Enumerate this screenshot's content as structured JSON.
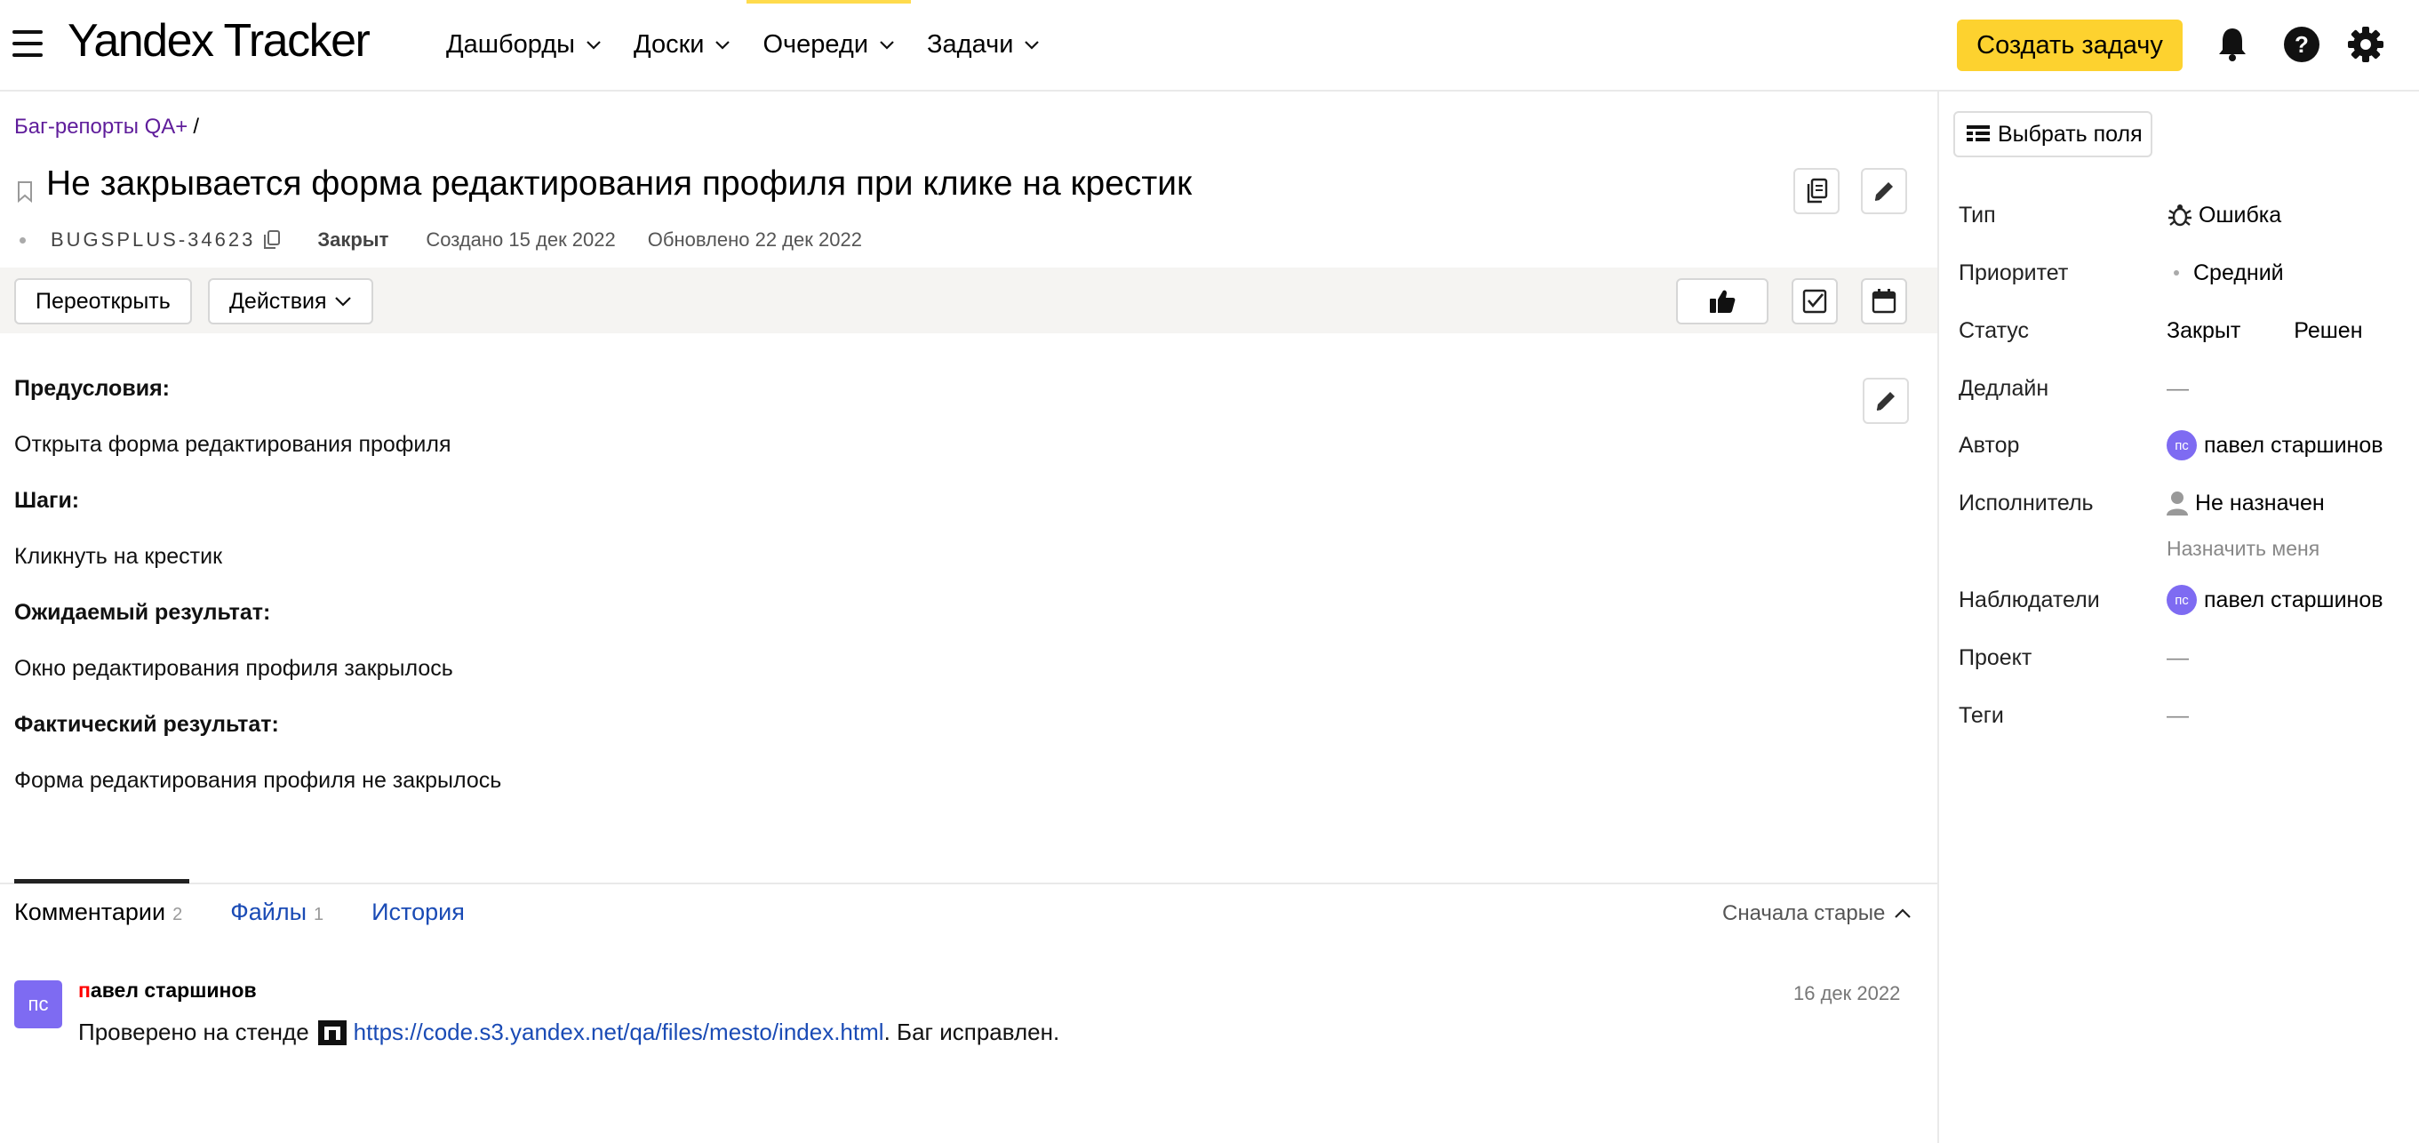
{
  "header": {
    "logo": "Yandex Tracker",
    "nav": [
      {
        "label": "Дашборды"
      },
      {
        "label": "Доски"
      },
      {
        "label": "Очереди"
      },
      {
        "label": "Задачи"
      }
    ],
    "create_button": "Создать задачу"
  },
  "issue": {
    "breadcrumb": "Баг-репорты QA+",
    "breadcrumb_sep": "/",
    "title": "Не закрывается форма редактирования профиля при клике на крестик",
    "key": "BUGSPLUS-34623",
    "status": "Закрыт",
    "created": "Создано 15 дек 2022",
    "updated": "Обновлено 22 дек 2022"
  },
  "actions": {
    "reopen": "Переоткрыть",
    "more": "Действия"
  },
  "description": {
    "pre_title": "Предусловия:",
    "pre_text": "Открыта форма редактирования профиля",
    "steps_title": "Шаги:",
    "steps_text": "Кликнуть на крестик",
    "expected_title": "Ожидаемый результат:",
    "expected_text": "Окно редактирования профиля закрылось",
    "actual_title": "Фактический результат:",
    "actual_text": "Форма редактирования профиля не закрылось"
  },
  "tabs": {
    "comments": "Комментарии",
    "comments_count": "2",
    "files": "Файлы",
    "files_count": "1",
    "history": "История",
    "sort": "Сначала старые"
  },
  "comment": {
    "avatar": "пс",
    "author_first": "п",
    "author_rest": "авел старшинов",
    "date": "16 дек 2022",
    "text_before": "Проверено на стенде",
    "link": "https://code.s3.yandex.net/qa/files/mesto/index.html",
    "text_after": ". Баг исправлен."
  },
  "sidebar": {
    "fields_button": "Выбрать поля",
    "type_label": "Тип",
    "type_value": "Ошибка",
    "priority_label": "Приоритет",
    "priority_value": "Средний",
    "status_label": "Статус",
    "status_value": "Закрыт",
    "resolution_value": "Решен",
    "deadline_label": "Дедлайн",
    "deadline_value": "—",
    "author_label": "Автор",
    "author_avatar": "пс",
    "author_value": "павел старшинов",
    "assignee_label": "Исполнитель",
    "assignee_value": "Не назначен",
    "assign_me": "Назначить меня",
    "followers_label": "Наблюдатели",
    "followers_avatar": "пс",
    "followers_value": "павел старшинов",
    "project_label": "Проект",
    "project_value": "—",
    "tags_label": "Теги",
    "tags_value": "—"
  }
}
